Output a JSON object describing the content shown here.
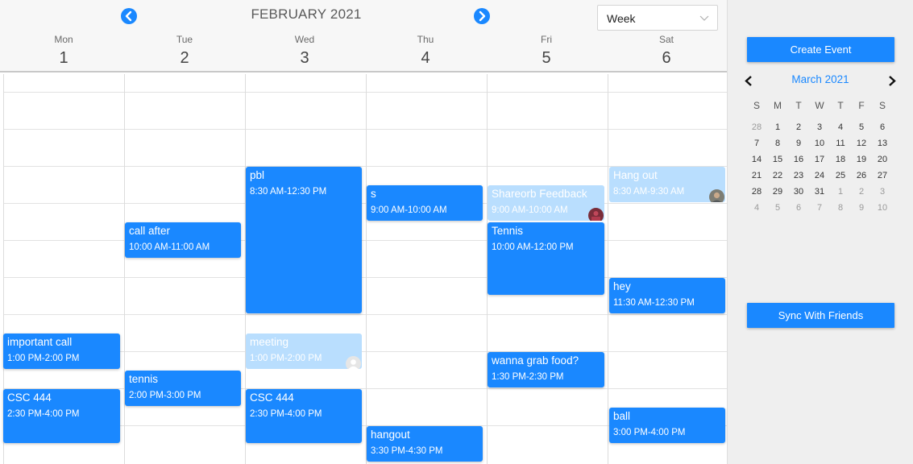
{
  "header": {
    "month_title": "FEBRUARY 2021",
    "view_selected": "Week"
  },
  "days": [
    {
      "name": "Mon",
      "date": "1"
    },
    {
      "name": "Tue",
      "date": "2"
    },
    {
      "name": "Wed",
      "date": "3"
    },
    {
      "name": "Thu",
      "date": "4"
    },
    {
      "name": "Fri",
      "date": "5"
    },
    {
      "name": "Sat",
      "date": "6"
    }
  ],
  "events": [
    {
      "day": 0,
      "start": 13.0,
      "end": 14.0,
      "title": "important call",
      "time": "1:00 PM-2:00 PM",
      "faded": false
    },
    {
      "day": 0,
      "start": 14.5,
      "end": 16.0,
      "title": "CSC 444",
      "time": "2:30 PM-4:00 PM",
      "faded": false
    },
    {
      "day": 1,
      "start": 10.0,
      "end": 11.0,
      "title": "call after",
      "time": "10:00 AM-11:00 AM",
      "faded": false
    },
    {
      "day": 1,
      "start": 14.0,
      "end": 15.0,
      "title": "tennis",
      "time": "2:00 PM-3:00 PM",
      "faded": false
    },
    {
      "day": 2,
      "start": 8.5,
      "end": 12.5,
      "title": "pbl",
      "time": "8:30 AM-12:30 PM",
      "faded": false
    },
    {
      "day": 2,
      "start": 13.0,
      "end": 14.0,
      "title": "meeting",
      "time": "1:00 PM-2:00 PM",
      "faded": true,
      "avatar": "gray-person"
    },
    {
      "day": 2,
      "start": 14.5,
      "end": 16.0,
      "title": "CSC 444",
      "time": "2:30 PM-4:00 PM",
      "faded": false
    },
    {
      "day": 3,
      "start": 9.0,
      "end": 10.0,
      "title": "s",
      "time": "9:00 AM-10:00 AM",
      "faded": false
    },
    {
      "day": 3,
      "start": 15.5,
      "end": 16.5,
      "title": "hangout",
      "time": "3:30 PM-4:30 PM",
      "faded": false
    },
    {
      "day": 4,
      "start": 9.0,
      "end": 10.0,
      "title": "Shareorb Feedback",
      "time": "9:00 AM-10:00 AM",
      "faded": true,
      "avatar": "red-photo"
    },
    {
      "day": 4,
      "start": 10.0,
      "end": 12.0,
      "title": "Tennis",
      "time": "10:00 AM-12:00 PM",
      "faded": false
    },
    {
      "day": 4,
      "start": 13.5,
      "end": 14.5,
      "title": "wanna grab food?",
      "time": "1:30 PM-2:30 PM",
      "faded": false
    },
    {
      "day": 5,
      "start": 8.5,
      "end": 9.5,
      "title": "Hang out",
      "time": "8:30 AM-9:30 AM",
      "faded": true,
      "avatar": "man-photo"
    },
    {
      "day": 5,
      "start": 11.5,
      "end": 12.5,
      "title": "hey",
      "time": "11:30 AM-12:30 PM",
      "faded": false
    },
    {
      "day": 5,
      "start": 15.0,
      "end": 16.0,
      "title": "ball",
      "time": "3:00 PM-4:00 PM",
      "faded": false
    }
  ],
  "side": {
    "create_label": "Create Event",
    "sync_label": "Sync With Friends",
    "mini_title": "March 2021",
    "weekdays": [
      "S",
      "M",
      "T",
      "W",
      "T",
      "F",
      "S"
    ],
    "weeks": [
      [
        [
          "28",
          true
        ],
        [
          "1",
          false
        ],
        [
          "2",
          false
        ],
        [
          "3",
          false
        ],
        [
          "4",
          false
        ],
        [
          "5",
          false
        ],
        [
          "6",
          false
        ]
      ],
      [
        [
          "7",
          false
        ],
        [
          "8",
          false
        ],
        [
          "9",
          false
        ],
        [
          "10",
          false
        ],
        [
          "11",
          false
        ],
        [
          "12",
          false
        ],
        [
          "13",
          false
        ]
      ],
      [
        [
          "14",
          false
        ],
        [
          "15",
          false
        ],
        [
          "16",
          false
        ],
        [
          "17",
          false
        ],
        [
          "18",
          false
        ],
        [
          "19",
          false
        ],
        [
          "20",
          false
        ]
      ],
      [
        [
          "21",
          false
        ],
        [
          "22",
          false
        ],
        [
          "23",
          false
        ],
        [
          "24",
          false
        ],
        [
          "25",
          false
        ],
        [
          "26",
          false
        ],
        [
          "27",
          false
        ]
      ],
      [
        [
          "28",
          false
        ],
        [
          "29",
          false
        ],
        [
          "30",
          false
        ],
        [
          "31",
          false
        ],
        [
          "1",
          true
        ],
        [
          "2",
          true
        ],
        [
          "3",
          true
        ]
      ],
      [
        [
          "4",
          true
        ],
        [
          "5",
          true
        ],
        [
          "6",
          true
        ],
        [
          "7",
          true
        ],
        [
          "8",
          true
        ],
        [
          "9",
          true
        ],
        [
          "10",
          true
        ]
      ]
    ]
  },
  "colors": {
    "accent": "#1a88ff",
    "faded_event": "#b9defe",
    "sidebar_bg": "#efefef"
  }
}
